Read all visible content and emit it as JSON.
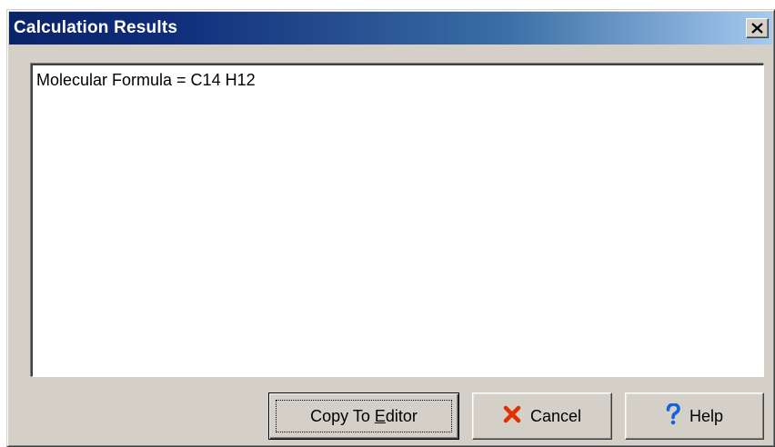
{
  "window": {
    "title": "Calculation Results"
  },
  "output": {
    "text": "Molecular Formula = C14 H12"
  },
  "buttons": {
    "copy": {
      "label_prefix": "Copy To ",
      "label_accel": "E",
      "label_suffix": "ditor"
    },
    "cancel": {
      "label": "Cancel",
      "icon": "x-icon"
    },
    "help": {
      "label": "Help",
      "icon": "question-mark-icon"
    }
  },
  "colors": {
    "title_bar_start": "#0a246a",
    "title_bar_end": "#a6caf0",
    "dialog_face": "#d4d0c8",
    "cancel_icon": "#e03000",
    "help_icon": "#1060e0"
  }
}
